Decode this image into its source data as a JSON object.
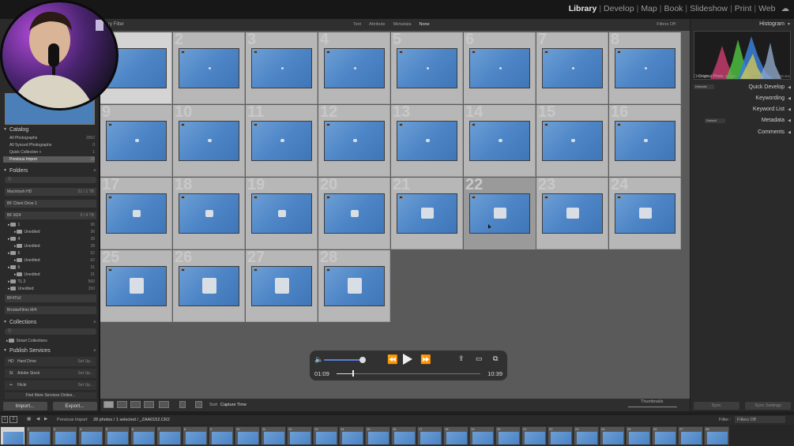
{
  "modules": [
    "Library",
    "Develop",
    "Map",
    "Book",
    "Slideshow",
    "Print",
    "Web"
  ],
  "active_module": "Library",
  "filter_bar": {
    "label": "ry Filter",
    "options": [
      "Text",
      "Attribute",
      "Metadata",
      "None"
    ],
    "active_option": "None",
    "filters_off": "Filters Off"
  },
  "left_panel": {
    "catalog": {
      "title": "Catalog",
      "items": [
        {
          "label": "All Photographs",
          "count": "2562"
        },
        {
          "label": "All Synced Photographs",
          "count": "0"
        },
        {
          "label": "Quick Collection +",
          "count": "1"
        },
        {
          "label": "Previous Import",
          "count": "28"
        }
      ]
    },
    "folders": {
      "title": "Folders",
      "search_placeholder": "Q",
      "volumes": [
        {
          "label": "Macintosh HD",
          "count": "51 / 1 TB"
        },
        {
          "label": "BF Client Drive 1",
          "count": ""
        },
        {
          "label": "BF M24",
          "count": "0 / 4 TB"
        }
      ],
      "items": [
        {
          "label": "1",
          "count": "36",
          "indent": 1
        },
        {
          "label": "Unedited",
          "count": "36",
          "indent": 2
        },
        {
          "label": "4",
          "count": "28",
          "indent": 1
        },
        {
          "label": "Unedited",
          "count": "28",
          "indent": 2
        },
        {
          "label": "5",
          "count": "62",
          "indent": 1
        },
        {
          "label": "Unedited",
          "count": "62",
          "indent": 2
        },
        {
          "label": "6",
          "count": "31",
          "indent": 1
        },
        {
          "label": "Unedited",
          "count": "31",
          "indent": 2
        },
        {
          "label": "TL 2",
          "count": "560",
          "indent": 1
        },
        {
          "label": "Unedited",
          "count": "150",
          "indent": 1
        }
      ],
      "extra_volumes": [
        "BF4Tb2",
        "BrookeFilms M/4"
      ]
    },
    "collections": {
      "title": "Collections",
      "search_placeholder": "Q",
      "items": [
        "Smart Collections"
      ]
    },
    "publish_services": {
      "title": "Publish Services",
      "items": [
        {
          "label": "Hard Drive",
          "action": "Set Up...",
          "icon": "HD"
        },
        {
          "label": "Adobe Stock",
          "action": "Set Up...",
          "icon": "St"
        },
        {
          "label": "Flickr",
          "action": "Set Up...",
          "icon": "••"
        }
      ],
      "more_label": "Find More Services Online..."
    },
    "import_label": "Import...",
    "export_label": "Export..."
  },
  "grid": {
    "cells": [
      {
        "num": "1"
      },
      {
        "num": "2"
      },
      {
        "num": "3"
      },
      {
        "num": "4"
      },
      {
        "num": "5"
      },
      {
        "num": "6"
      },
      {
        "num": "7"
      },
      {
        "num": "8"
      },
      {
        "num": "9"
      },
      {
        "num": "10"
      },
      {
        "num": "11"
      },
      {
        "num": "12"
      },
      {
        "num": "13"
      },
      {
        "num": "14"
      },
      {
        "num": "15"
      },
      {
        "num": "16"
      },
      {
        "num": "17"
      },
      {
        "num": "18"
      },
      {
        "num": "19"
      },
      {
        "num": "20"
      },
      {
        "num": "21"
      },
      {
        "num": "22"
      },
      {
        "num": "23"
      },
      {
        "num": "24"
      },
      {
        "num": "25"
      },
      {
        "num": "26"
      },
      {
        "num": "27"
      },
      {
        "num": "28"
      }
    ],
    "selected": "1",
    "current": "22"
  },
  "bottom_toolbar": {
    "sort_label": "Sort",
    "sort_value": "Capture Time",
    "thumbnails_label": "Thumbnails"
  },
  "player": {
    "current_time": "01:09",
    "total_time": "10:39",
    "progress": 0.108,
    "volume": 0.85
  },
  "right_panel": {
    "histogram_title": "Histogram",
    "histogram_info": [
      "ISO 500",
      "32 mm",
      "f / 8.0",
      "1/10 sec"
    ],
    "original_photo": "Original Photo",
    "panels": [
      "Quick Develop",
      "Keywording",
      "Keyword List",
      "Metadata",
      "Comments"
    ],
    "quick_develop_preset": "Defaults",
    "metadata_preset": "Default",
    "sync_label": "Sync",
    "sync_settings_label": "Sync Settings"
  },
  "filmstrip_bar": {
    "page_buttons": [
      "1",
      "2"
    ],
    "source": "Previous Import",
    "summary": "28 photos / 1 selected / _ZAA0152.CR2",
    "filter_label": "Filter :",
    "filter_value": "Filters Off"
  },
  "colors": {
    "accent": "#5a7fd6",
    "photo_blue": "#4d85c6",
    "grid_bg": "#5a5a5a",
    "cell_bg": "#b7b7b7"
  }
}
